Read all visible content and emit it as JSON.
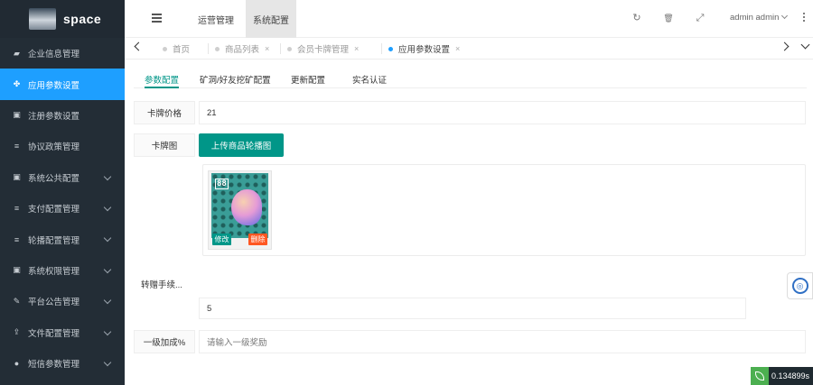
{
  "app": {
    "logo_text": "space"
  },
  "sidebar": {
    "items": [
      {
        "label": "企业信息管理",
        "icon": "book-icon",
        "glyph": "▰",
        "active": false,
        "caret": false
      },
      {
        "label": "应用参数设置",
        "icon": "app-icon",
        "glyph": "✤",
        "active": true,
        "caret": false
      },
      {
        "label": "注册参数设置",
        "icon": "user-card-icon",
        "glyph": "▣",
        "active": false,
        "caret": false
      },
      {
        "label": "协议政策管理",
        "icon": "list-icon",
        "glyph": "≡",
        "active": false,
        "caret": false
      },
      {
        "label": "系统公共配置",
        "icon": "user-card-icon",
        "glyph": "▣",
        "active": false,
        "caret": true
      },
      {
        "label": "支付配置管理",
        "icon": "list-icon",
        "glyph": "≡",
        "active": false,
        "caret": true
      },
      {
        "label": "轮播配置管理",
        "icon": "list-icon",
        "glyph": "≡",
        "active": false,
        "caret": true
      },
      {
        "label": "系统权限管理",
        "icon": "user-card-icon",
        "glyph": "▣",
        "active": false,
        "caret": true
      },
      {
        "label": "平台公告管理",
        "icon": "edit-icon",
        "glyph": "✎",
        "active": false,
        "caret": true
      },
      {
        "label": "文件配置管理",
        "icon": "upload-icon",
        "glyph": "⇪",
        "active": false,
        "caret": true
      },
      {
        "label": "短信参数管理",
        "icon": "user-circle-icon",
        "glyph": "●",
        "active": false,
        "caret": true
      }
    ]
  },
  "header": {
    "nav_ops": "运营管理",
    "nav_sys": "系统配置",
    "refresh_glyph": "↻",
    "clear_glyph": "🗑",
    "fullscreen_glyph": "⤢",
    "user": "admin admin"
  },
  "tabs": [
    {
      "label": "首页",
      "closable": false,
      "active": false
    },
    {
      "label": "商品列表",
      "closable": true,
      "active": false
    },
    {
      "label": "会员卡牌管理",
      "closable": true,
      "active": false
    },
    {
      "label": "应用参数设置",
      "closable": true,
      "active": true
    }
  ],
  "content_tabs": [
    {
      "label": "参数配置",
      "active": true
    },
    {
      "label": "矿洞/好友挖矿配置",
      "active": false
    },
    {
      "label": "更新配置",
      "active": false
    },
    {
      "label": "实名认证",
      "active": false
    }
  ],
  "form": {
    "card_price_label": "卡牌价格",
    "card_price_value": "21",
    "card_image_label": "卡牌图",
    "upload_button": "上传商品轮播图",
    "card_number": "88",
    "edit_button": "修改",
    "delete_button": "删除",
    "transfer_fee_label": "转赠手续...",
    "transfer_fee_value": "5",
    "level1_bonus_label": "一级加成%",
    "level1_bonus_placeholder": "请输入一级奖励"
  },
  "corner_badge": {
    "text": "0.134899s"
  },
  "colors": {
    "sidebar_bg": "#232d36",
    "sidebar_active": "#1e9fff",
    "primary_green": "#009688",
    "danger_orange": "#ff5722"
  }
}
